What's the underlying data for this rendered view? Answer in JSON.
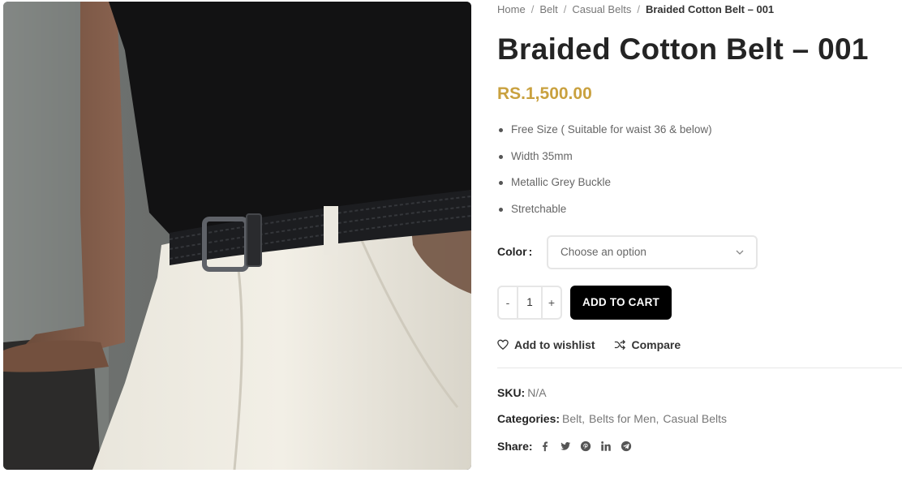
{
  "breadcrumb": {
    "items": [
      "Home",
      "Belt",
      "Casual Belts"
    ],
    "current": "Braided Cotton Belt – 001"
  },
  "product": {
    "title": "Braided Cotton Belt – 001",
    "price": "RS.1,500.00",
    "features": [
      "Free Size ( Suitable for waist 36 & below)",
      "Width 35mm",
      "Metallic Grey Buckle",
      "Stretchable"
    ]
  },
  "variation": {
    "label": "Color",
    "colon": ":",
    "selected": "Choose an option"
  },
  "cart": {
    "minus": "-",
    "quantity": "1",
    "plus": "+",
    "add_label": "ADD TO CART"
  },
  "actions": {
    "wishlist": "Add to wishlist",
    "compare": "Compare"
  },
  "meta": {
    "sku_label": "SKU:",
    "sku_value": "N/A",
    "categories_label": "Categories:",
    "categories": [
      "Belt",
      "Belts for Men",
      "Casual Belts"
    ],
    "share_label": "Share:",
    "share_icons": [
      "facebook-icon",
      "twitter-icon",
      "pinterest-icon",
      "linkedin-icon",
      "telegram-icon"
    ]
  },
  "colors": {
    "price": "#c9a13f",
    "button": "#000000",
    "title": "#242424"
  }
}
